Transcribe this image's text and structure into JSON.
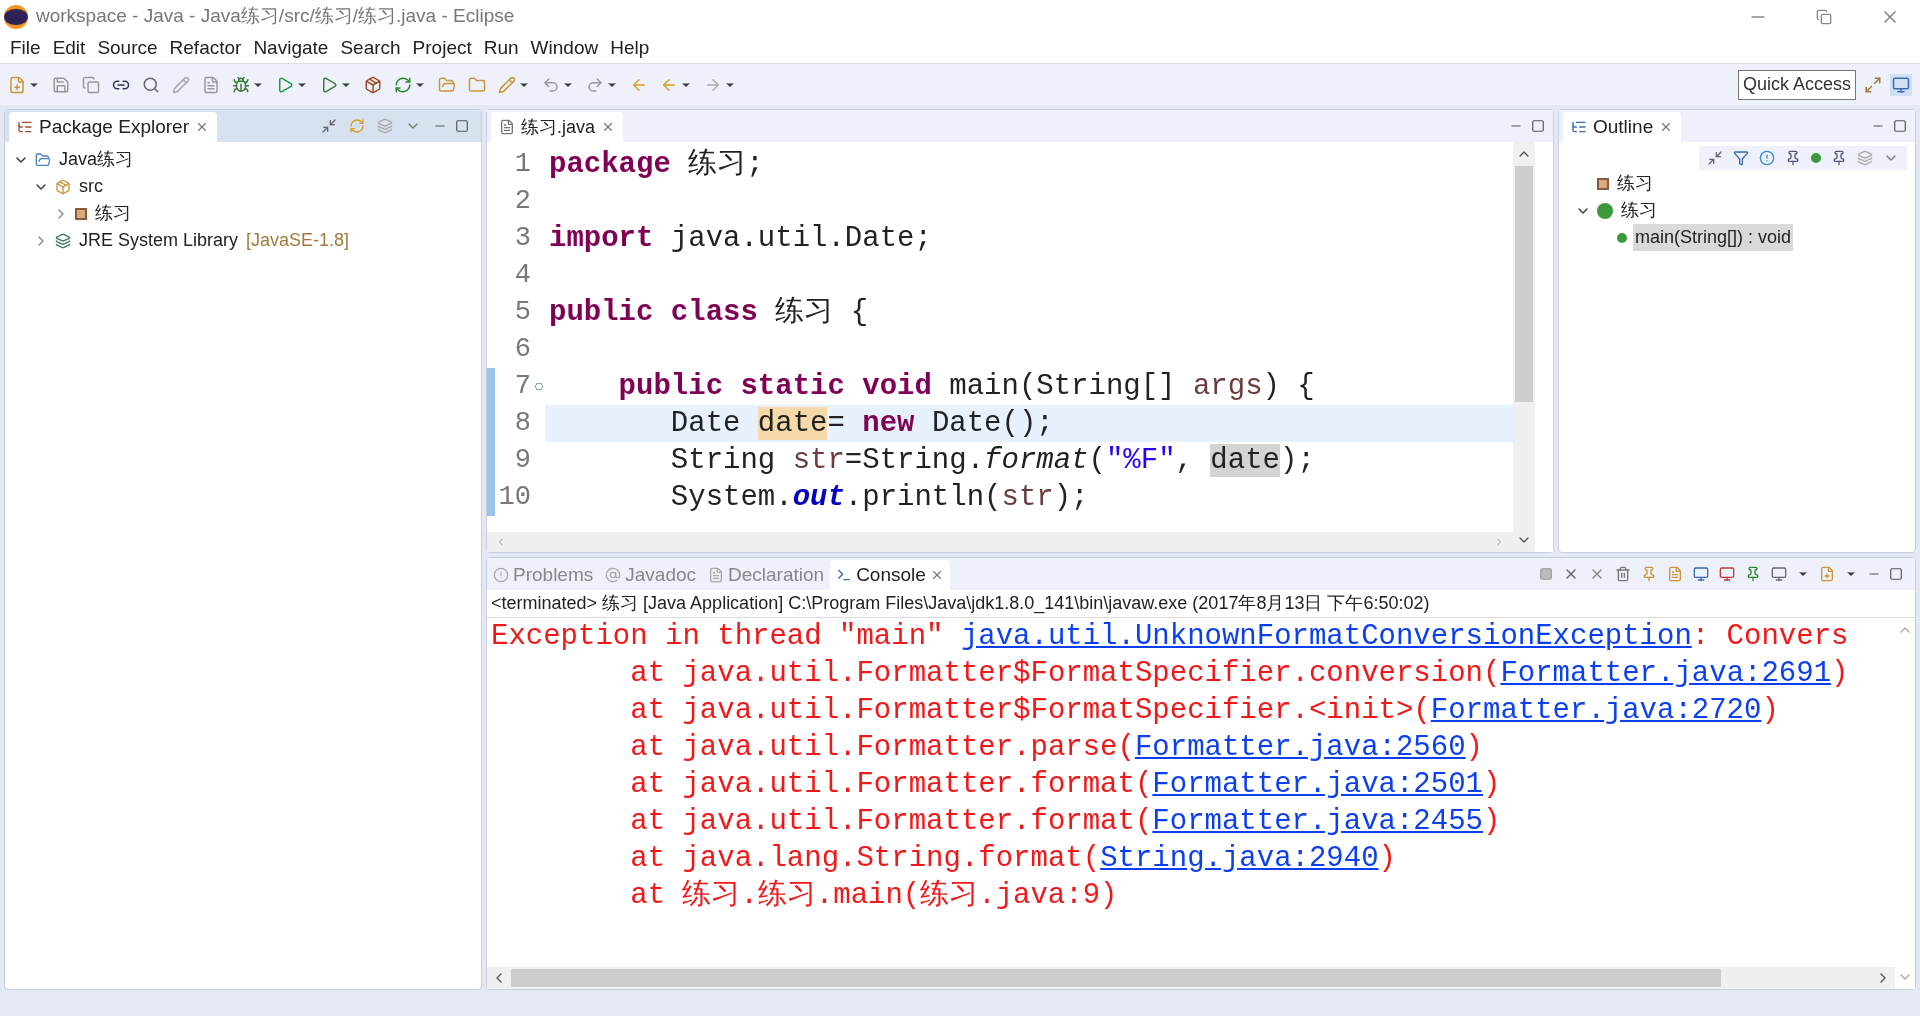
{
  "window": {
    "title": "workspace - Java - Java练习/src/练习/练习.java - Eclipse"
  },
  "menu": [
    "File",
    "Edit",
    "Source",
    "Refactor",
    "Navigate",
    "Search",
    "Project",
    "Run",
    "Window",
    "Help"
  ],
  "quick_access": {
    "placeholder": "Quick Access"
  },
  "package_explorer": {
    "tab": "Package Explorer",
    "tree": [
      {
        "kind": "project",
        "label": "Java练习",
        "expanded": true,
        "children": [
          {
            "kind": "source-folder",
            "label": "src",
            "expanded": true,
            "children": [
              {
                "kind": "package",
                "label": "练习",
                "expanded": false
              }
            ]
          },
          {
            "kind": "library",
            "label": "JRE System Library",
            "decoration": "[JavaSE-1.8]",
            "expanded": false
          }
        ]
      }
    ]
  },
  "editor": {
    "tab": "练习.java",
    "lines": [
      {
        "number": "1",
        "current": false,
        "changed": false,
        "fold_marker": false,
        "tokens": [
          {
            "kind": "keyword",
            "text": "package"
          },
          {
            "kind": "plain",
            "text": " 练习;"
          }
        ]
      },
      {
        "number": "2",
        "current": false,
        "changed": false,
        "fold_marker": false
      },
      {
        "number": "3",
        "current": false,
        "changed": false,
        "fold_marker": false,
        "tokens": [
          {
            "kind": "keyword",
            "text": "import"
          },
          {
            "kind": "plain",
            "text": " java.util.Date;"
          }
        ]
      },
      {
        "number": "4",
        "current": false,
        "changed": false,
        "fold_marker": false
      },
      {
        "number": "5",
        "current": false,
        "changed": false,
        "fold_marker": false,
        "tokens": [
          {
            "kind": "keyword",
            "text": "public class"
          },
          {
            "kind": "plain",
            "text": " 练习 {"
          }
        ]
      },
      {
        "number": "6",
        "current": false,
        "changed": false,
        "fold_marker": false
      },
      {
        "number": "7",
        "current": false,
        "changed": true,
        "fold_marker": true,
        "tokens": [
          {
            "kind": "keyword",
            "text": "    public static void"
          },
          {
            "kind": "plain",
            "text": " main(String[] "
          },
          {
            "kind": "local",
            "text": "args"
          },
          {
            "kind": "plain",
            "text": ") {"
          }
        ]
      },
      {
        "number": "8",
        "current": true,
        "changed": true,
        "fold_marker": false,
        "tokens": [
          {
            "kind": "plain",
            "text": "       Date "
          },
          {
            "kind": "occurrence_write",
            "text": "date"
          },
          {
            "kind": "plain",
            "text": "= "
          },
          {
            "kind": "keyword",
            "text": "new"
          },
          {
            "kind": "plain",
            "text": " Date();"
          }
        ]
      },
      {
        "number": "9",
        "current": false,
        "changed": true,
        "fold_marker": false,
        "tokens": [
          {
            "kind": "plain",
            "text": "       String "
          },
          {
            "kind": "local",
            "text": "str"
          },
          {
            "kind": "plain",
            "text": "=String."
          },
          {
            "kind": "italic",
            "text": "format"
          },
          {
            "kind": "plain",
            "text": "("
          },
          {
            "kind": "string",
            "text": "\"%F\""
          },
          {
            "kind": "plain",
            "text": ", "
          },
          {
            "kind": "occurrence_read",
            "text": "date"
          },
          {
            "kind": "plain",
            "text": ");"
          }
        ]
      },
      {
        "number": "10",
        "current": false,
        "changed": true,
        "fold_marker": false,
        "tokens": [
          {
            "kind": "plain",
            "text": "       System."
          },
          {
            "kind": "static_field",
            "text": "out"
          },
          {
            "kind": "plain",
            "text": ".println("
          },
          {
            "kind": "local",
            "text": "str"
          },
          {
            "kind": "plain",
            "text": ");"
          }
        ]
      }
    ]
  },
  "outline": {
    "tab": "Outline",
    "tree": [
      {
        "kind": "package",
        "label": "练习",
        "selected": false
      },
      {
        "kind": "class",
        "label": "练习",
        "selected": false,
        "expanded": true,
        "children": [
          {
            "kind": "method",
            "label": "main(String[]) : void",
            "selected": true
          }
        ]
      }
    ]
  },
  "console_tabs": [
    {
      "label": "Problems",
      "selected": false
    },
    {
      "label": "Javadoc",
      "selected": false
    },
    {
      "label": "Declaration",
      "selected": false
    },
    {
      "label": "Console",
      "selected": true
    }
  ],
  "console": {
    "status": "<terminated> 练习 [Java Application] C:\\Program Files\\Java\\jdk1.8.0_141\\bin\\javaw.exe (2017年8月13日 下午6:50:02)",
    "lines": [
      {
        "segments": [
          {
            "kind": "text",
            "text": "Exception in thread \"main\" "
          },
          {
            "kind": "link",
            "text": "java.util.UnknownFormatConversionException"
          },
          {
            "kind": "text",
            "text": ": Convers"
          }
        ]
      },
      {
        "segments": [
          {
            "kind": "text",
            "text": "\tat java.util.Formatter$FormatSpecifier.conversion("
          },
          {
            "kind": "link",
            "text": "Formatter.java:2691"
          },
          {
            "kind": "text",
            "text": ")"
          }
        ]
      },
      {
        "segments": [
          {
            "kind": "text",
            "text": "\tat java.util.Formatter$FormatSpecifier.<init>("
          },
          {
            "kind": "link",
            "text": "Formatter.java:2720"
          },
          {
            "kind": "text",
            "text": ")"
          }
        ]
      },
      {
        "segments": [
          {
            "kind": "text",
            "text": "\tat java.util.Formatter.parse("
          },
          {
            "kind": "link",
            "text": "Formatter.java:2560"
          },
          {
            "kind": "text",
            "text": ")"
          }
        ]
      },
      {
        "segments": [
          {
            "kind": "text",
            "text": "\tat java.util.Formatter.format("
          },
          {
            "kind": "link",
            "text": "Formatter.java:2501"
          },
          {
            "kind": "text",
            "text": ")"
          }
        ]
      },
      {
        "segments": [
          {
            "kind": "text",
            "text": "\tat java.util.Formatter.format("
          },
          {
            "kind": "link",
            "text": "Formatter.java:2455"
          },
          {
            "kind": "text",
            "text": ")"
          }
        ]
      },
      {
        "segments": [
          {
            "kind": "text",
            "text": "\tat java.lang.String.format("
          },
          {
            "kind": "link",
            "text": "String.java:2940"
          },
          {
            "kind": "text",
            "text": ")"
          }
        ]
      },
      {
        "segments": [
          {
            "kind": "text",
            "text": "\tat 练习.练习.main(练习.java:9)"
          }
        ]
      }
    ]
  }
}
